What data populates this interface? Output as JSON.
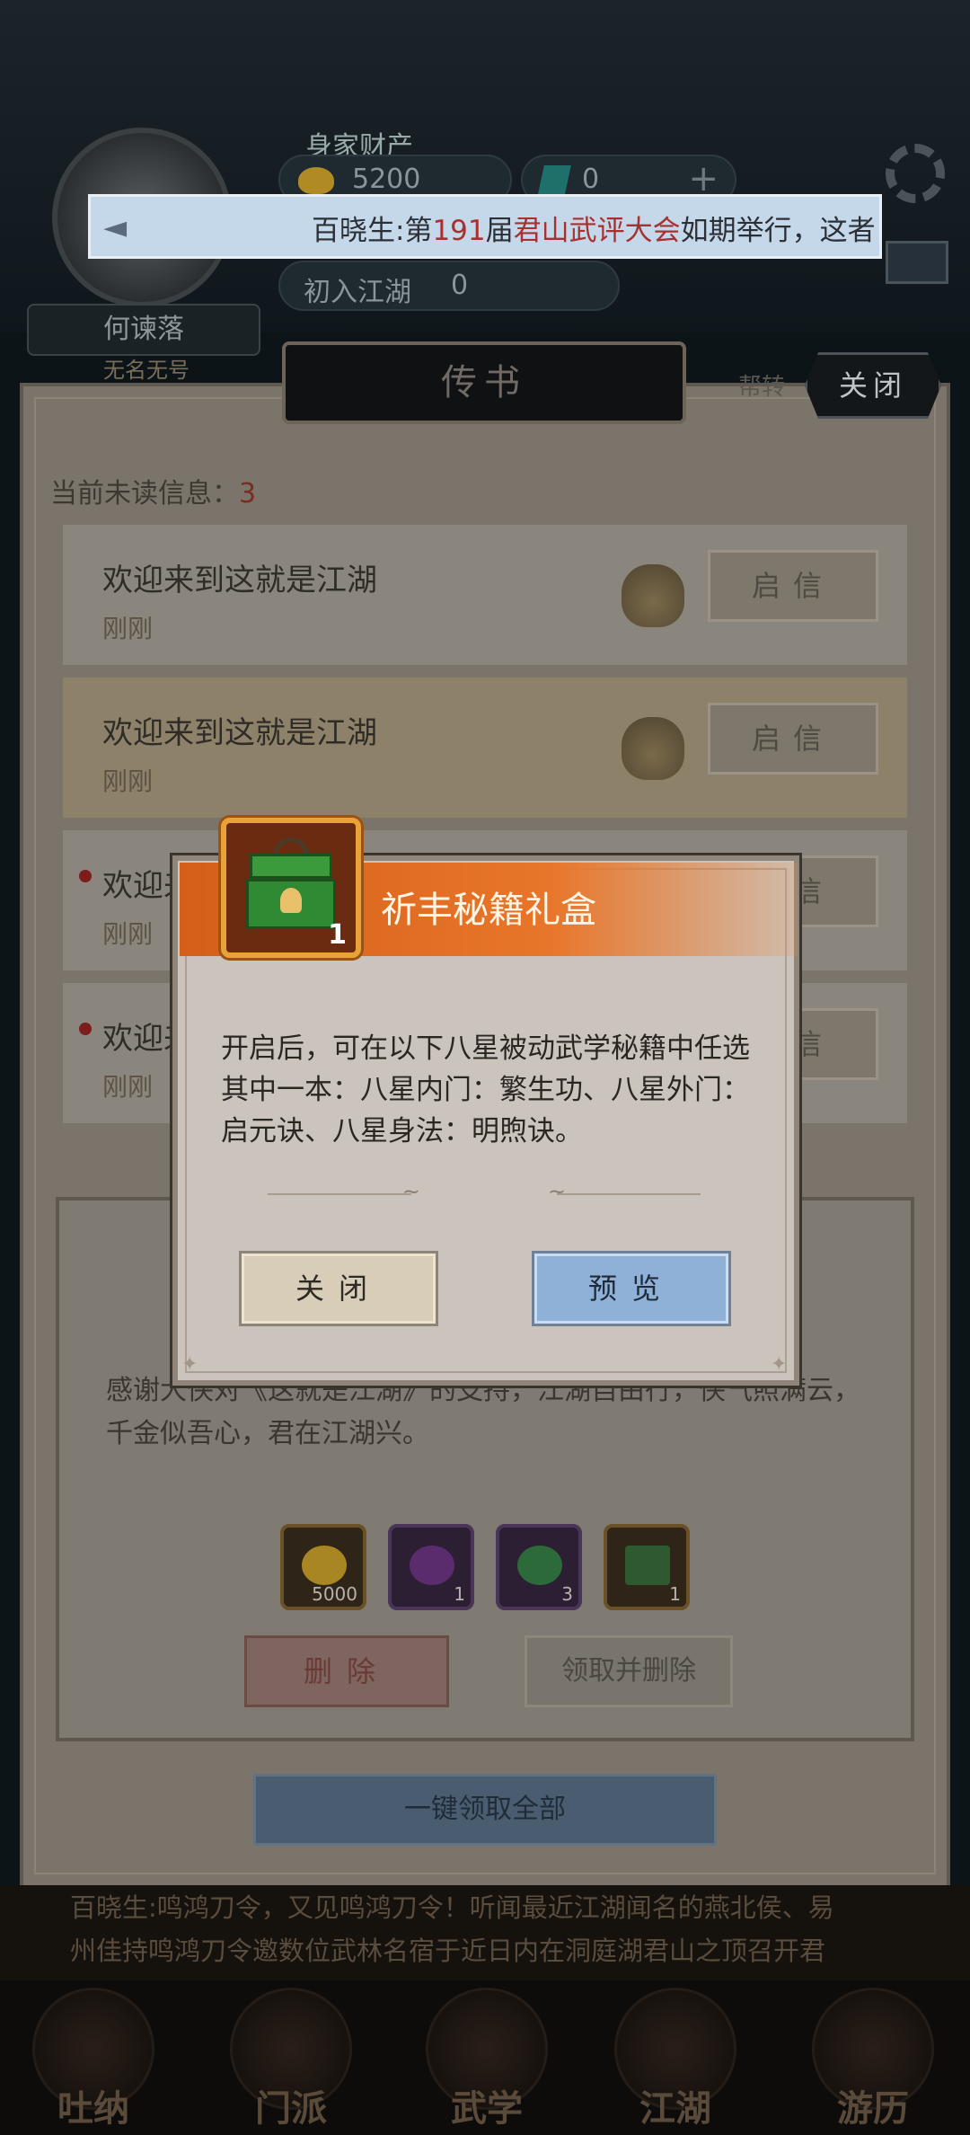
{
  "header": {
    "wealth_label": "身家财产",
    "ingots": "5200",
    "gems": "0",
    "rank": "初入江湖",
    "rank_value": "0",
    "player_name": "何谏落",
    "player_title": "无名无号"
  },
  "marquee": {
    "prefix": "百晓生:第",
    "num": "191",
    "mid": "届",
    "place": "君山武评大会",
    "suffix": "如期举行，这者"
  },
  "mail_panel": {
    "title": "传书",
    "close_label": "关闭",
    "hint": "帮转",
    "unread_label": "当前未读信息：",
    "unread_count": "3",
    "rows": [
      {
        "subject": "欢迎来到这就是江湖",
        "time": "刚刚",
        "button": "启信"
      },
      {
        "subject": "欢迎来到这就是江湖",
        "time": "刚刚",
        "button": "启信"
      },
      {
        "subject": "欢迎来",
        "time": "刚刚",
        "button": "启信"
      },
      {
        "subject": "欢迎来",
        "time": "刚刚",
        "button": "启信"
      }
    ],
    "detail_body": "感谢大侠对《这就是江湖》的支持，江湖自由行，侠气照满云，千金似吾心，君在江湖兴。",
    "rewards": [
      {
        "icon": "gold-ingot-icon",
        "count": "5000"
      },
      {
        "icon": "purple-orb-icon",
        "count": "1"
      },
      {
        "icon": "green-orb-icon",
        "count": "3"
      },
      {
        "icon": "green-chest-icon",
        "count": "1"
      }
    ],
    "delete_label": "删除",
    "claim_delete_label": "领取并删除",
    "claim_all_label": "一键领取全部"
  },
  "news": {
    "line1": "百晓生:鸣鸿刀令，又见鸣鸿刀令！听闻最近江湖闻名的燕北侯、易",
    "line2": "州佳持鸣鸿刀令邀数位武林名宿于近日内在洞庭湖君山之顶召开君"
  },
  "nav": [
    {
      "label": "吐纳"
    },
    {
      "label": "门派"
    },
    {
      "label": "武学"
    },
    {
      "label": "江湖"
    },
    {
      "label": "游历"
    }
  ],
  "modal": {
    "title": "祈丰秘籍礼盒",
    "item_count": "1",
    "description": "开启后，可在以下八星被动武学秘籍中任选其中一本：八星内门：繁生功、八星外门：启元诀、八星身法：明煦诀。",
    "close_label": "关闭",
    "preview_label": "预览"
  },
  "colors": {
    "banner": "#e8762a",
    "preview_button": "#90b1d7",
    "close_button": "#d8cdb8"
  }
}
